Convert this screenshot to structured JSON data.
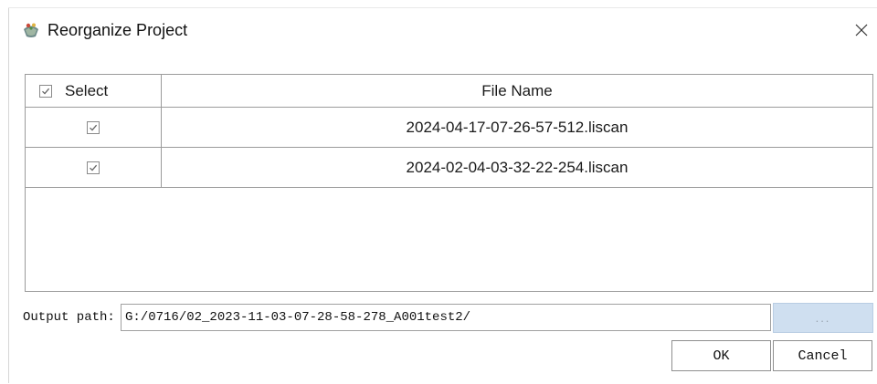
{
  "window": {
    "title": "Reorganize Project"
  },
  "table": {
    "columns": [
      "Select",
      "File Name"
    ],
    "header_checked": true,
    "rows": [
      {
        "checked": true,
        "file_name": "2024-04-17-07-26-57-512.liscan"
      },
      {
        "checked": true,
        "file_name": "2024-02-04-03-32-22-254.liscan"
      }
    ]
  },
  "output": {
    "label": "Output path:",
    "value": "G:/0716/02_2023-11-03-07-28-58-278_A001test2/",
    "browse_label": "..."
  },
  "buttons": {
    "ok": "OK",
    "cancel": "Cancel"
  },
  "icons": {
    "app": "app-icon",
    "close": "close-icon",
    "check": "check-icon"
  },
  "colors": {
    "browse_bg": "#cfdff0",
    "grid_border": "#9b9b9b"
  }
}
